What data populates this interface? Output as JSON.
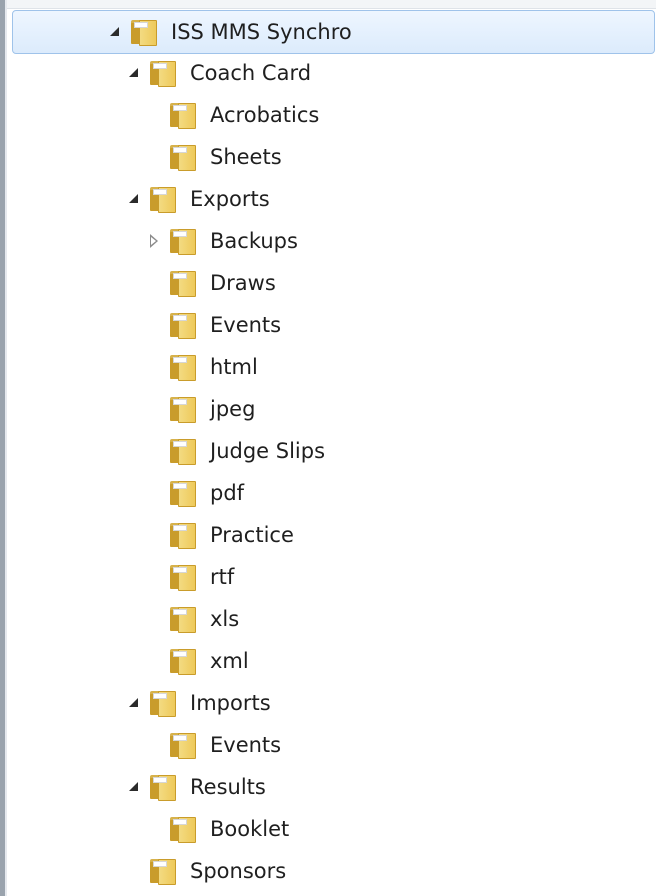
{
  "tree": {
    "items": [
      {
        "label": "ISS MMS Synchro",
        "expander": "expanded",
        "selected": true
      },
      {
        "label": "Coach Card",
        "expander": "expanded"
      },
      {
        "label": "Acrobatics",
        "expander": "none"
      },
      {
        "label": "Sheets",
        "expander": "none"
      },
      {
        "label": "Exports",
        "expander": "expanded"
      },
      {
        "label": "Backups",
        "expander": "collapsed"
      },
      {
        "label": "Draws",
        "expander": "none"
      },
      {
        "label": "Events",
        "expander": "none"
      },
      {
        "label": "html",
        "expander": "none"
      },
      {
        "label": "jpeg",
        "expander": "none"
      },
      {
        "label": "Judge Slips",
        "expander": "none"
      },
      {
        "label": "pdf",
        "expander": "none"
      },
      {
        "label": "Practice",
        "expander": "none"
      },
      {
        "label": "rtf",
        "expander": "none"
      },
      {
        "label": "xls",
        "expander": "none"
      },
      {
        "label": "xml",
        "expander": "none"
      },
      {
        "label": "Imports",
        "expander": "expanded"
      },
      {
        "label": "Events",
        "expander": "none"
      },
      {
        "label": "Results",
        "expander": "expanded"
      },
      {
        "label": "Booklet",
        "expander": "none"
      },
      {
        "label": "Sponsors",
        "expander": "none"
      }
    ]
  },
  "icons": {
    "folder": "folder-icon",
    "expanded": "expanded-triangle-icon",
    "collapsed": "collapsed-triangle-icon"
  },
  "colors": {
    "selection_border": "#9fc3ea",
    "selection_fill": "#dcebfc",
    "text": "#1f1f1f",
    "folder": "#eec95a"
  }
}
